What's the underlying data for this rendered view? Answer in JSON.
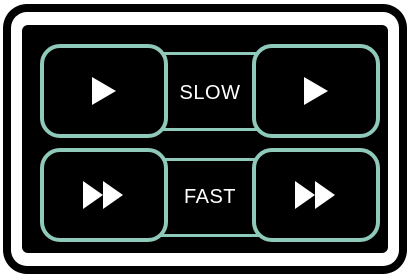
{
  "controls": {
    "slow": {
      "label": "SLOW",
      "left_button_icon": "play-icon",
      "right_button_icon": "play-icon"
    },
    "fast": {
      "label": "FAST",
      "left_button_icon": "fast-forward-icon",
      "right_button_icon": "fast-forward-icon"
    }
  },
  "colors": {
    "frame": "#000000",
    "bezel": "#ffffff",
    "panel": "#000000",
    "button_outline": "#8fc9ba",
    "icon": "#ffffff",
    "label": "#ffffff"
  }
}
